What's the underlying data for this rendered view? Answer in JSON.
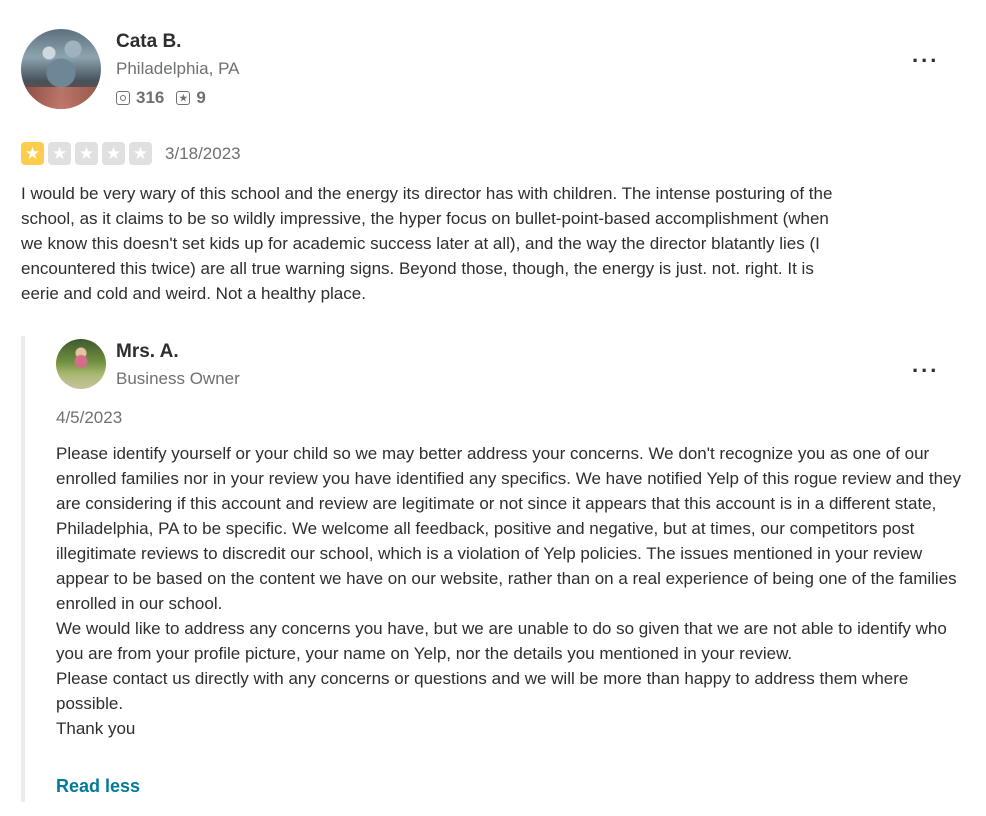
{
  "review": {
    "user": {
      "name": "Cata B.",
      "location": "Philadelphia, PA",
      "friends_count": "316",
      "reviews_count": "9"
    },
    "rating": 1,
    "max_rating": 5,
    "star_color": "#ffcc4b",
    "star_empty_color": "#e0e0e0",
    "date": "3/18/2023",
    "text": "I would be very wary of this school and the energy its director has with children. The intense posturing of the school, as it claims to be so wildly impressive, the hyper focus on bullet-point-based accomplishment (when we know this doesn't set kids up for academic success later at all), and the way the director blatantly lies (I encountered this twice) are all true warning signs. Beyond those, though, the energy is just. not. right. It is eerie and cold and weird. Not a healthy place.",
    "more_label": "..."
  },
  "reply": {
    "owner_name": "Mrs. A.",
    "owner_role": "Business Owner",
    "date": "4/5/2023",
    "paragraphs": [
      "Please identify yourself or your child so we may better address your concerns. We don't recognize you as one of our enrolled families  nor in your review you have identified any specifics. We have notified Yelp of this rogue review and they are considering if this account and review are legitimate or not since it appears that this account is in a different state, Philadelphia, PA to be specific. We welcome all feedback, positive and negative, but at times, our competitors post illegitimate reviews to discredit our school, which is a violation of Yelp policies. The issues mentioned in your review appear to be based on the content we have on our website, rather than on a real experience of being one of the families enrolled in our school.",
      "We would like to address any concerns you have, but we are unable to do so given that we are not able to identify who you are from your profile picture, your name on Yelp, nor the details you mentioned in your review.",
      "Please contact us directly with any concerns or questions and we will be more than happy to address them where possible.",
      "Thank you"
    ],
    "read_less_label": "Read less",
    "more_label": "...",
    "link_color": "#027a97"
  }
}
